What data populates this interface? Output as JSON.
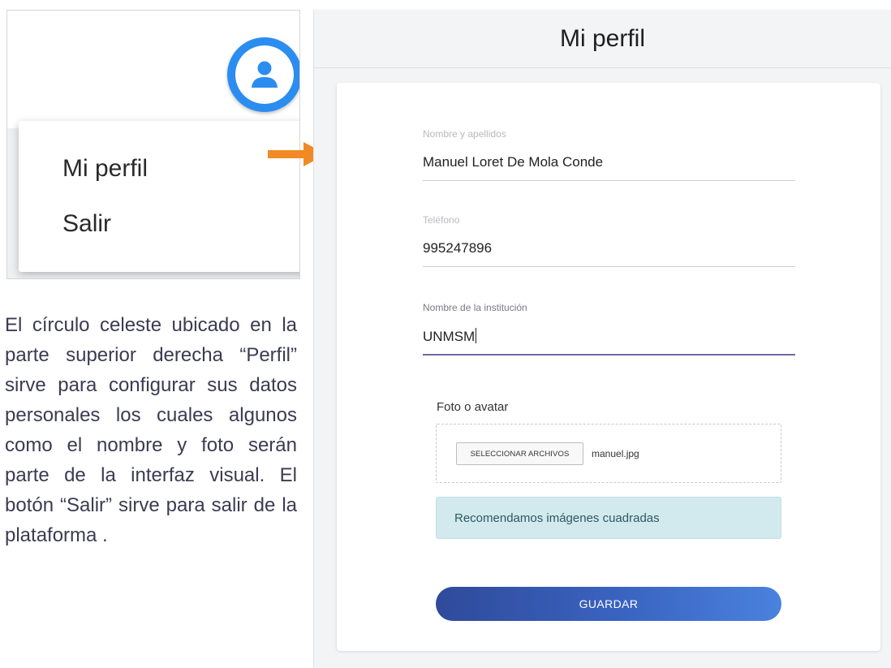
{
  "menu": {
    "profile_label": "Mi perfil",
    "logout_label": "Salir",
    "avatar_icon": "user-avatar-icon",
    "accent_color": "#2b8df0"
  },
  "description": "El círculo celeste ubicado en la parte superior derecha “Perfil” sirve para configurar sus datos personales los cuales algunos como el nombre y foto serán parte de la interfaz visual. El botón “Salir” sirve para salir de la plataforma .",
  "arrow": {
    "icon": "arrow-right-icon",
    "color": "#f08a24"
  },
  "profile": {
    "title": "Mi perfil",
    "fields": [
      {
        "label": "Nombre y apellidos",
        "value": "Manuel Loret De Mola Conde"
      },
      {
        "label": "Teléfono",
        "value": "995247896"
      },
      {
        "label": "Nombre de la institución",
        "value": "UNMSM"
      }
    ],
    "photo_label": "Foto o avatar",
    "file_button": "SELECCIONAR ARCHIVOS",
    "file_name": "manuel.jpg",
    "info_text": "Recomendamos imágenes cuadradas",
    "save_label": "GUARDAR",
    "button_color": "#3a64c2"
  }
}
